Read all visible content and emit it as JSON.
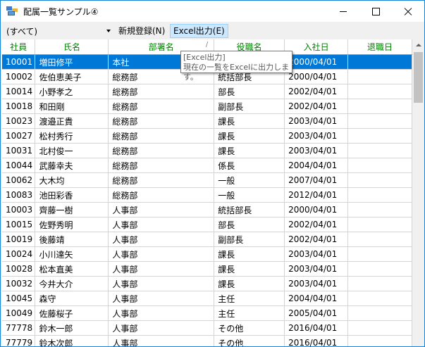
{
  "window": {
    "title": "配属一覧サンプル④"
  },
  "toolbar": {
    "combo_value": "(すべて)",
    "new_label": "新規登録(N)",
    "excel_label": "Excel出力(E)"
  },
  "tooltip": {
    "title": "[Excel出力]",
    "body": "現在の一覧をExcelに出力します。"
  },
  "table": {
    "columns": [
      "社員",
      "氏名",
      "部署名",
      "役職名",
      "入社日",
      "退職日"
    ],
    "rows": [
      [
        "10001",
        "増田修平",
        "本社",
        "",
        "2000/04/01",
        ""
      ],
      [
        "10002",
        "佐伯恵美子",
        "総務部",
        "統括部長",
        "2000/04/01",
        ""
      ],
      [
        "10014",
        "小野孝之",
        "総務部",
        "部長",
        "2002/04/01",
        ""
      ],
      [
        "10018",
        "和田剛",
        "総務部",
        "副部長",
        "2002/04/01",
        ""
      ],
      [
        "10023",
        "渡邉正貴",
        "総務部",
        "課長",
        "2003/04/01",
        ""
      ],
      [
        "10027",
        "松村秀行",
        "総務部",
        "課長",
        "2003/04/01",
        ""
      ],
      [
        "10031",
        "北村俊一",
        "総務部",
        "課長",
        "2003/04/01",
        ""
      ],
      [
        "10044",
        "武藤幸夫",
        "総務部",
        "係長",
        "2004/04/01",
        ""
      ],
      [
        "10062",
        "大木均",
        "総務部",
        "一般",
        "2007/04/01",
        ""
      ],
      [
        "10083",
        "池田彩香",
        "総務部",
        "一般",
        "2012/04/01",
        ""
      ],
      [
        "10003",
        "齊藤一樹",
        "人事部",
        "統括部長",
        "2000/04/01",
        ""
      ],
      [
        "10015",
        "佐野秀明",
        "人事部",
        "部長",
        "2002/04/01",
        ""
      ],
      [
        "10019",
        "後藤靖",
        "人事部",
        "副部長",
        "2002/04/01",
        ""
      ],
      [
        "10024",
        "小川達矢",
        "人事部",
        "課長",
        "2003/04/01",
        ""
      ],
      [
        "10028",
        "松本直美",
        "人事部",
        "課長",
        "2003/04/01",
        ""
      ],
      [
        "10032",
        "今井大介",
        "人事部",
        "課長",
        "2003/04/01",
        ""
      ],
      [
        "10045",
        "森守",
        "人事部",
        "主任",
        "2004/04/01",
        ""
      ],
      [
        "10049",
        "佐藤桜子",
        "人事部",
        "主任",
        "2005/04/01",
        ""
      ],
      [
        "77778",
        "鈴木一郎",
        "人事部",
        "その他",
        "2016/04/01",
        ""
      ],
      [
        "77779",
        "鈴木次郎",
        "人事部",
        "その他",
        "2016/04/01",
        ""
      ]
    ],
    "selected_index": 0,
    "sort_marker": "/"
  },
  "colors": {
    "header_text": "#008000",
    "selection": "#0078d7",
    "window_border": "#1883d7"
  }
}
